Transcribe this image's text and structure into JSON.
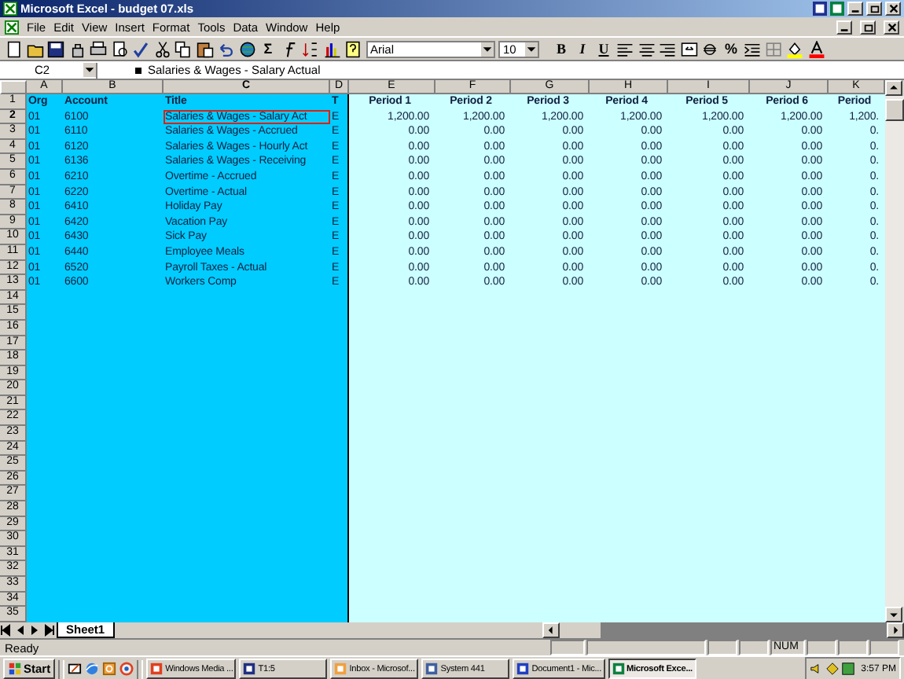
{
  "window": {
    "title": "Microsoft Excel - budget 07.xls"
  },
  "menu": [
    "File",
    "Edit",
    "View",
    "Insert",
    "Format",
    "Tools",
    "Data",
    "Window",
    "Help"
  ],
  "toolbar": {
    "sum_button": "Σ",
    "font": "Arial",
    "font_size": "10",
    "format_buttons": [
      "B",
      "I",
      "U"
    ],
    "percent_button": "%"
  },
  "formula_bar": {
    "name_box": "C2",
    "formula": "Salaries & Wages - Salary Actual"
  },
  "columns": [
    {
      "letter": "A",
      "kind": "text",
      "selected": false,
      "color": "#00ccff"
    },
    {
      "letter": "B",
      "kind": "text",
      "selected": false,
      "color": "#00ccff"
    },
    {
      "letter": "C",
      "kind": "text",
      "selected": true,
      "color": "#00ccff"
    },
    {
      "letter": "D",
      "kind": "text",
      "selected": false,
      "color": "#00ccff"
    },
    {
      "letter": "E",
      "kind": "number",
      "selected": false,
      "color": "#ccffff"
    },
    {
      "letter": "F",
      "kind": "number",
      "selected": false,
      "color": "#ccffff"
    },
    {
      "letter": "G",
      "kind": "number",
      "selected": false,
      "color": "#ccffff"
    },
    {
      "letter": "H",
      "kind": "number",
      "selected": false,
      "color": "#ccffff"
    },
    {
      "letter": "I",
      "kind": "number",
      "selected": false,
      "color": "#ccffff"
    },
    {
      "letter": "J",
      "kind": "number",
      "selected": false,
      "color": "#ccffff"
    },
    {
      "letter": "K",
      "kind": "number",
      "selected": false,
      "color": "#ccffff"
    }
  ],
  "rows": [
    {
      "number": "1",
      "kind": "heading",
      "selected": false,
      "cells": [
        "Org",
        "Account",
        "Title",
        "T",
        "Period 1",
        "Period 2",
        "Period 3",
        "Period 4",
        "Period 5",
        "Period 6",
        "Period"
      ]
    },
    {
      "number": "2",
      "kind": "data",
      "selected": true,
      "cells": [
        "01",
        "6100",
        "Salaries & Wages - Salary Act",
        "E",
        "1,200.00",
        "1,200.00",
        "1,200.00",
        "1,200.00",
        "1,200.00",
        "1,200.00",
        "1,200."
      ]
    },
    {
      "number": "3",
      "kind": "data",
      "selected": false,
      "cells": [
        "01",
        "6110",
        "Salaries & Wages - Accrued",
        "E",
        "0.00",
        "0.00",
        "0.00",
        "0.00",
        "0.00",
        "0.00",
        "0."
      ]
    },
    {
      "number": "4",
      "kind": "data",
      "selected": false,
      "cells": [
        "01",
        "6120",
        "Salaries & Wages - Hourly Act",
        "E",
        "0.00",
        "0.00",
        "0.00",
        "0.00",
        "0.00",
        "0.00",
        "0."
      ]
    },
    {
      "number": "5",
      "kind": "data",
      "selected": false,
      "cells": [
        "01",
        "6136",
        "Salaries & Wages - Receiving",
        "E",
        "0.00",
        "0.00",
        "0.00",
        "0.00",
        "0.00",
        "0.00",
        "0."
      ]
    },
    {
      "number": "6",
      "kind": "data",
      "selected": false,
      "cells": [
        "01",
        "6210",
        "Overtime - Accrued",
        "E",
        "0.00",
        "0.00",
        "0.00",
        "0.00",
        "0.00",
        "0.00",
        "0."
      ]
    },
    {
      "number": "7",
      "kind": "data",
      "selected": false,
      "cells": [
        "01",
        "6220",
        "Overtime - Actual",
        "E",
        "0.00",
        "0.00",
        "0.00",
        "0.00",
        "0.00",
        "0.00",
        "0."
      ]
    },
    {
      "number": "8",
      "kind": "data",
      "selected": false,
      "cells": [
        "01",
        "6410",
        "Holiday Pay",
        "E",
        "0.00",
        "0.00",
        "0.00",
        "0.00",
        "0.00",
        "0.00",
        "0."
      ]
    },
    {
      "number": "9",
      "kind": "data",
      "selected": false,
      "cells": [
        "01",
        "6420",
        "Vacation Pay",
        "E",
        "0.00",
        "0.00",
        "0.00",
        "0.00",
        "0.00",
        "0.00",
        "0."
      ]
    },
    {
      "number": "10",
      "kind": "data",
      "selected": false,
      "cells": [
        "01",
        "6430",
        "Sick Pay",
        "E",
        "0.00",
        "0.00",
        "0.00",
        "0.00",
        "0.00",
        "0.00",
        "0."
      ]
    },
    {
      "number": "11",
      "kind": "data",
      "selected": false,
      "cells": [
        "01",
        "6440",
        "Employee Meals",
        "E",
        "0.00",
        "0.00",
        "0.00",
        "0.00",
        "0.00",
        "0.00",
        "0."
      ]
    },
    {
      "number": "12",
      "kind": "data",
      "selected": false,
      "cells": [
        "01",
        "6520",
        "Payroll Taxes - Actual",
        "E",
        "0.00",
        "0.00",
        "0.00",
        "0.00",
        "0.00",
        "0.00",
        "0."
      ]
    },
    {
      "number": "13",
      "kind": "data",
      "selected": false,
      "cells": [
        "01",
        "6600",
        "Workers Comp",
        "E",
        "0.00",
        "0.00",
        "0.00",
        "0.00",
        "0.00",
        "0.00",
        "0."
      ]
    }
  ],
  "empty_rows": [
    "14",
    "15",
    "16",
    "17",
    "18",
    "19",
    "20",
    "21",
    "22",
    "23",
    "24",
    "25",
    "26",
    "27",
    "28",
    "29",
    "30",
    "31",
    "32",
    "33",
    "34",
    "35"
  ],
  "sheet_tabs": [
    {
      "label": "Sheet1",
      "selected": true
    }
  ],
  "status_bar": {
    "text": "Ready",
    "indicators": [
      "NUM"
    ]
  },
  "taskbar": {
    "start": "Start",
    "tasks": [
      {
        "label": "Windows Media ...",
        "selected": false
      },
      {
        "label": "T1:5",
        "selected": false
      },
      {
        "label": "Inbox - Microsof...",
        "selected": false
      },
      {
        "label": "System 441",
        "selected": false
      },
      {
        "label": "Document1 - Mic...",
        "selected": false
      },
      {
        "label": "Microsoft Exce...",
        "selected": true
      }
    ],
    "clock": "3:57 PM"
  }
}
